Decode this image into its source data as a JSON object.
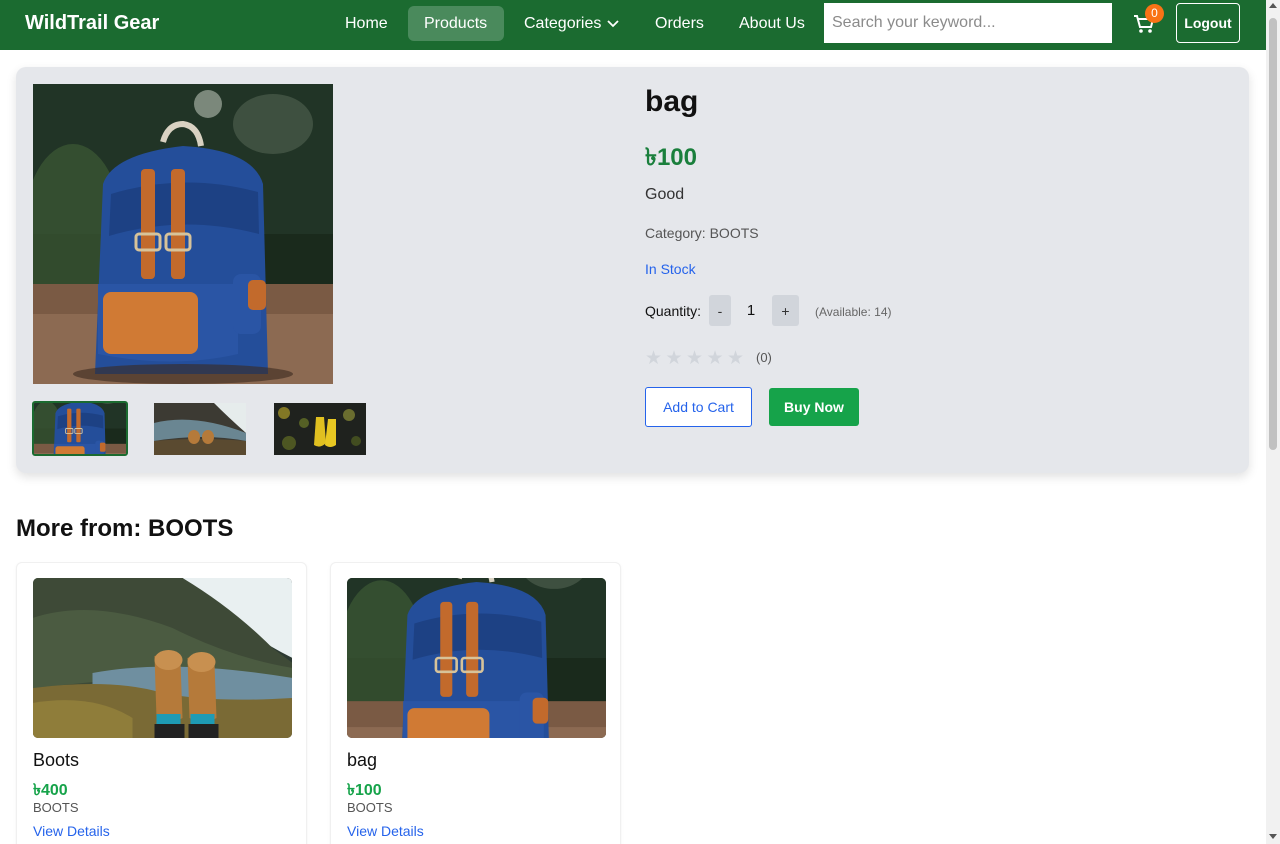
{
  "navbar": {
    "brand": "WildTrail Gear",
    "links": [
      "Home",
      "Products",
      "Categories",
      "Orders",
      "About Us"
    ],
    "active_link": "Products",
    "search_placeholder": "Search your keyword...",
    "cart_count": "0",
    "logout_label": "Logout",
    "colors": {
      "bar": "#1b6b30",
      "active": "#4a8a5c",
      "badge": "#f97316"
    },
    "icons": {
      "categories": "chevron-down-icon",
      "cart": "cart-icon"
    }
  },
  "product": {
    "title": "bag",
    "price": "৳100",
    "description": "Good",
    "category_line": "Category: BOOTS",
    "stock": "In Stock",
    "quantity_label": "Quantity:",
    "quantity_minus": "-",
    "quantity_value": "1",
    "quantity_plus": "+",
    "available": "(Available: 14)",
    "rating_stars": 0,
    "rating_count": "(0)",
    "add_to_cart_label": "Add to Cart",
    "buy_now_label": "Buy Now",
    "images": [
      "backpack-photo",
      "boots-cliff-photo",
      "yellow-boots-photo"
    ],
    "selected_image": "backpack-photo"
  },
  "related": {
    "title": "More from: BOOTS",
    "items": [
      {
        "name": "Boots",
        "price": "৳400",
        "category": "BOOTS",
        "link": "View Details",
        "image": "boots-cliff-photo"
      },
      {
        "name": "bag",
        "price": "৳100",
        "category": "BOOTS",
        "link": "View Details",
        "image": "backpack-photo"
      }
    ]
  }
}
